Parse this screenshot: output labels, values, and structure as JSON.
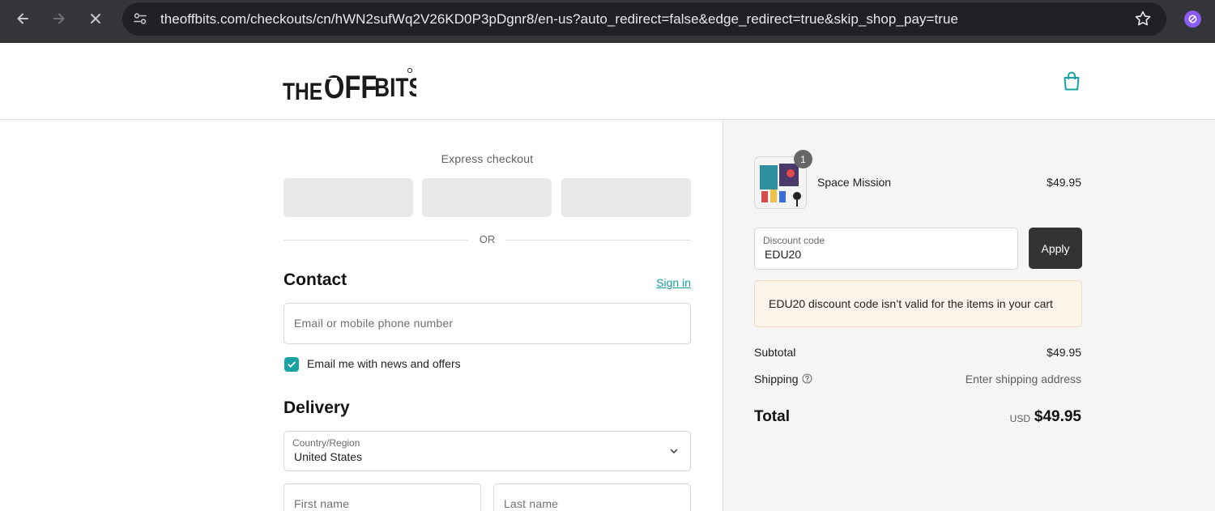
{
  "browser": {
    "url": "theoffbits.com/checkouts/cn/hWN2sufWq2V26KD0P3pDgnr8/en-us?auto_redirect=false&edge_redirect=true&skip_shop_pay=true"
  },
  "header": {
    "logo_alt": "THE OFFBITS",
    "cart_icon": "shopping-bag-icon"
  },
  "express": {
    "title": "Express checkout",
    "or": "OR"
  },
  "contact": {
    "heading": "Contact",
    "sign_in": "Sign in",
    "email_placeholder": "Email or mobile phone number",
    "newsletter_label": "Email me with news and offers",
    "newsletter_checked": true
  },
  "delivery": {
    "heading": "Delivery",
    "country_label": "Country/Region",
    "country_value": "United States",
    "first_name_placeholder": "First name",
    "last_name_placeholder": "Last name"
  },
  "summary": {
    "item": {
      "name": "Space Mission",
      "price": "$49.95",
      "quantity": "1"
    },
    "discount_label": "Discount code",
    "discount_value": "EDU20",
    "apply_label": "Apply",
    "error": "EDU20 discount code isn’t valid for the items in your cart",
    "subtotal_label": "Subtotal",
    "subtotal_value": "$49.95",
    "shipping_label": "Shipping",
    "shipping_value": "Enter shipping address",
    "total_label": "Total",
    "total_currency": "USD",
    "total_value": "$49.95"
  },
  "colors": {
    "accent": "#1aa3a4",
    "apply_button": "#333333",
    "error_background": "#fff4ea"
  }
}
